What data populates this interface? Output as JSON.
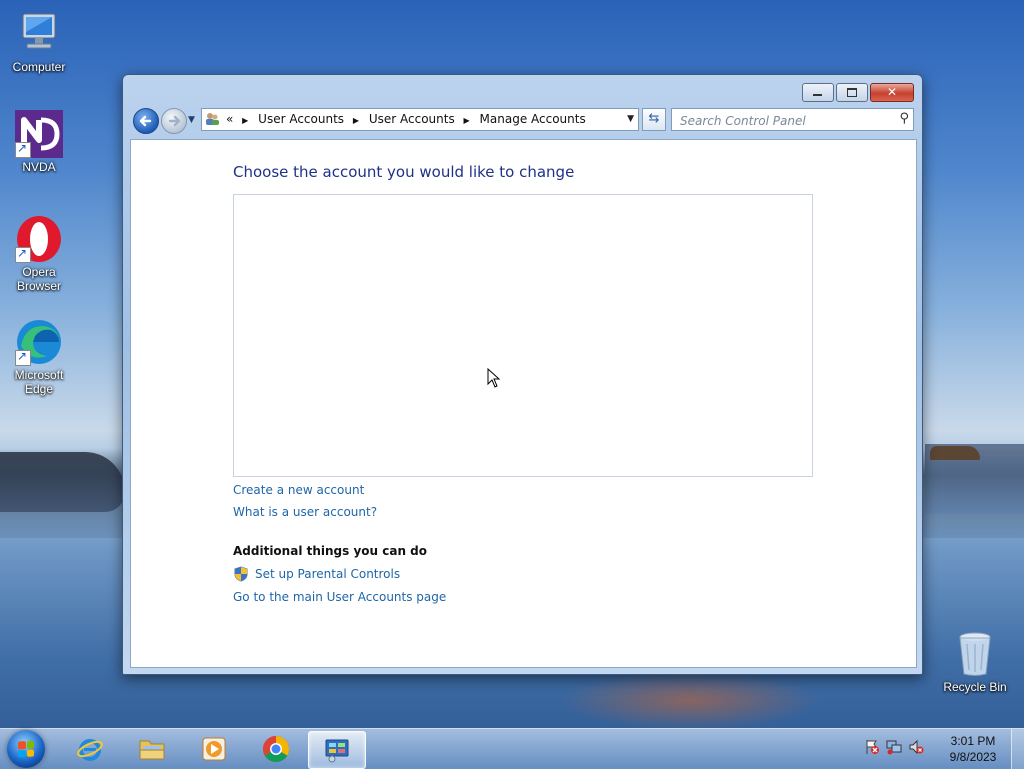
{
  "desktop": {
    "icons": [
      {
        "label": "Computer"
      },
      {
        "label": "NVDA"
      },
      {
        "label": "Opera Browser"
      },
      {
        "label": "Microsoft Edge"
      },
      {
        "label": "Recycle Bin"
      }
    ]
  },
  "window": {
    "controls": {
      "minimize": "",
      "maximize": "",
      "close": "✕"
    },
    "breadcrumb": {
      "prefix": "«",
      "items": [
        "User Accounts",
        "User Accounts",
        "Manage Accounts"
      ]
    },
    "search": {
      "placeholder": "Search Control Panel"
    },
    "content": {
      "heading": "Choose the account you would like to change",
      "links": {
        "create_account": "Create a new account",
        "what_is_account": "What is a user account?"
      },
      "additional": {
        "title": "Additional things you can do",
        "parental_controls": "Set up Parental Controls",
        "main_page": "Go to the main User Accounts page"
      }
    }
  },
  "taskbar": {
    "apps": [
      "Internet Explorer",
      "Windows Explorer",
      "Windows Media Player",
      "Google Chrome",
      "Control Panel"
    ],
    "active_app": "Control Panel",
    "clock": {
      "time": "3:01 PM",
      "date": "9/8/2023"
    }
  },
  "colors": {
    "link": "#1e66a8",
    "heading": "#1e3287"
  }
}
